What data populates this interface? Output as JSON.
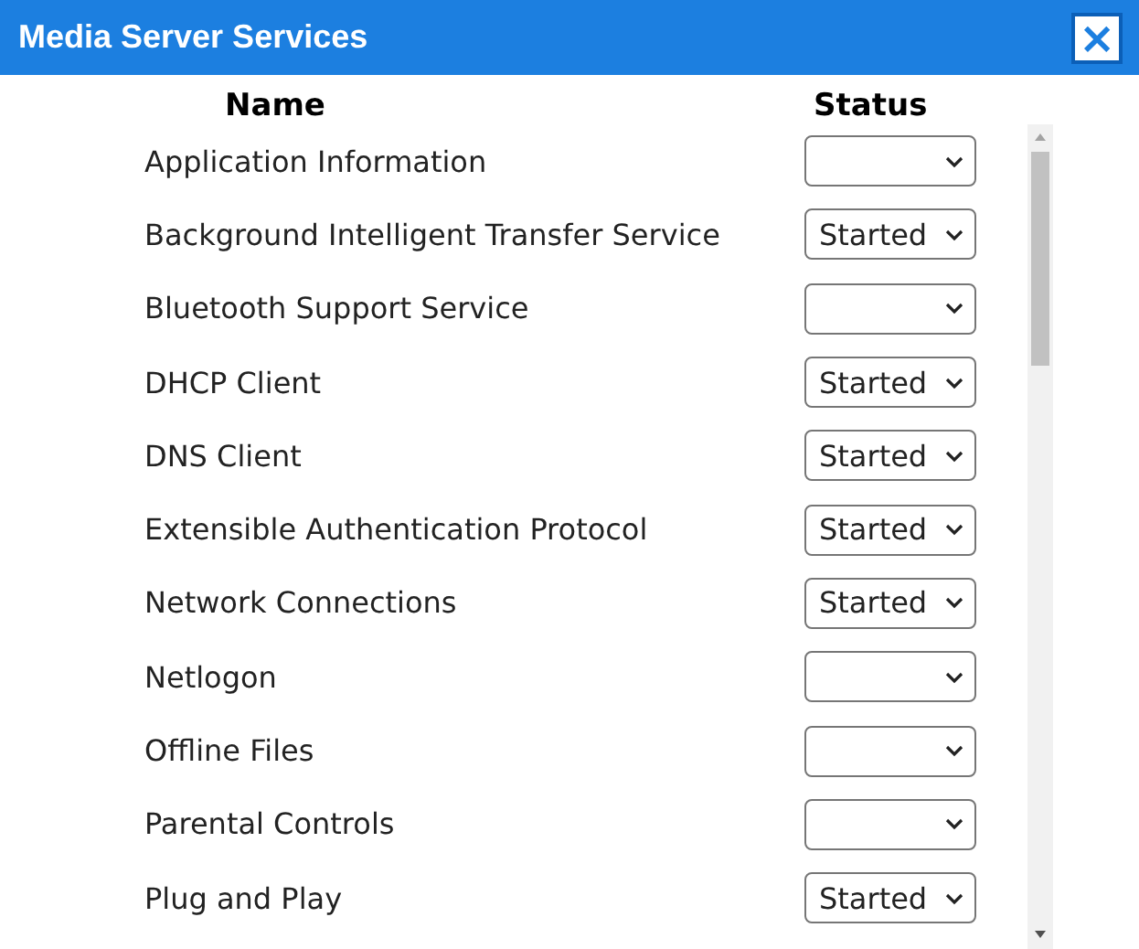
{
  "window": {
    "title": "Media Server Services",
    "close": "×"
  },
  "columns": [
    "Name",
    "Status"
  ],
  "services": [
    {
      "name": "Application Information"
    },
    {
      "name": "Background Intelligent Transfer Service",
      "status": "Started"
    },
    {
      "name": "Bluetooth Support Service"
    },
    {
      "name": "DHCP Client",
      "status": "Started"
    },
    {
      "name": "DNS Client",
      "status": "Started"
    },
    {
      "name": "Extensible Authentication Protocol",
      "status": "Started"
    },
    {
      "name": "Network Connections",
      "status": "Started"
    },
    {
      "name": "Netlogon"
    },
    {
      "name": "Offline Files"
    },
    {
      "name": "Parental Controls"
    },
    {
      "name": "Plug and Play",
      "status": "Started"
    }
  ]
}
